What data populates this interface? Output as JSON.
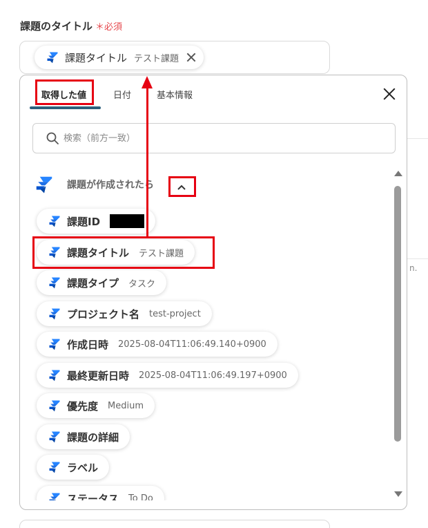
{
  "field": {
    "label": "課題のタイトル",
    "required_mark": "＊必須",
    "chip_name": "課題タイトル",
    "chip_value": "テスト課題"
  },
  "tabs": [
    {
      "label": "取得した値",
      "active": true
    },
    {
      "label": "日付",
      "active": false
    },
    {
      "label": "基本情報",
      "active": false
    }
  ],
  "search": {
    "placeholder": "検索（前方一致）"
  },
  "section": {
    "title": "課題が作成されたら"
  },
  "items": [
    {
      "name": "課題ID",
      "value": ""
    },
    {
      "name": "課題タイトル",
      "value": "テスト課題"
    },
    {
      "name": "課題タイプ",
      "value": "タスク"
    },
    {
      "name": "プロジェクト名",
      "value": "test-project"
    },
    {
      "name": "作成日時",
      "value": "2025-08-04T11:06:49.140+0900"
    },
    {
      "name": "最終更新日時",
      "value": "2025-08-04T11:06:49.197+0900"
    },
    {
      "name": "優先度",
      "value": "Medium"
    },
    {
      "name": "課題の詳細",
      "value": ""
    },
    {
      "name": "ラベル",
      "value": ""
    },
    {
      "name": "ステータス",
      "value": "To Do"
    }
  ],
  "background": {
    "fragment_text": "n."
  },
  "colors": {
    "annotation_red": "#e60012",
    "tab_underline": "#2d5f7c",
    "jira_blue": "#2684ff"
  },
  "icons": {
    "item_icon": "jira-icon",
    "search": "search-icon",
    "close": "close-icon",
    "collapse": "chevron-up-icon"
  }
}
